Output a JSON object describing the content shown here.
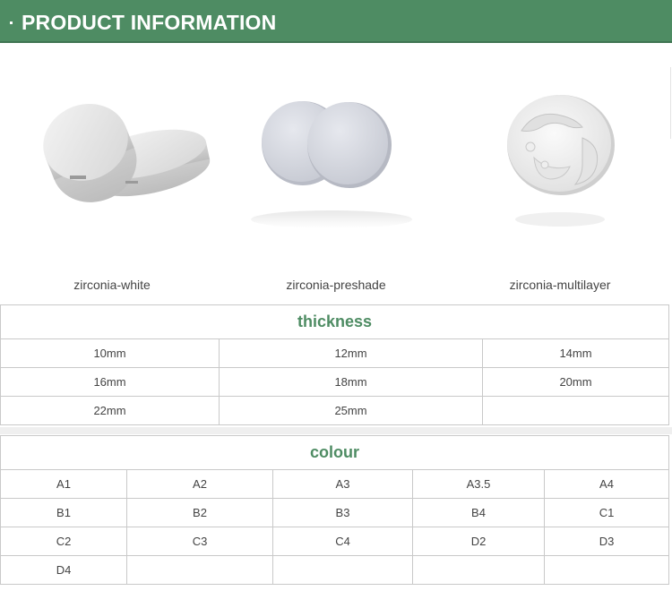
{
  "header": {
    "title": "PRODUCT INFORMATION",
    "accent_color": "#4e8c63"
  },
  "products": [
    {
      "label": "zirconia-white",
      "icon": "zirconia-white-disc-image"
    },
    {
      "label": "zirconia-preshade",
      "icon": "zirconia-preshade-disc-image"
    },
    {
      "label": "zirconia-multilayer",
      "icon": "zirconia-multilayer-disc-image"
    }
  ],
  "thickness": {
    "heading": "thickness",
    "rows": [
      [
        "10mm",
        "12mm",
        "14mm"
      ],
      [
        "16mm",
        "18mm",
        "20mm"
      ],
      [
        "22mm",
        "25mm",
        ""
      ]
    ]
  },
  "colour": {
    "heading": "colour",
    "rows": [
      [
        "A1",
        "A2",
        "A3",
        "A3.5",
        "A4"
      ],
      [
        "B1",
        "B2",
        "B3",
        "B4",
        "C1"
      ],
      [
        "C2",
        "C3",
        "C4",
        "D2",
        "D3"
      ],
      [
        "D4",
        "",
        "",
        "",
        ""
      ]
    ]
  }
}
